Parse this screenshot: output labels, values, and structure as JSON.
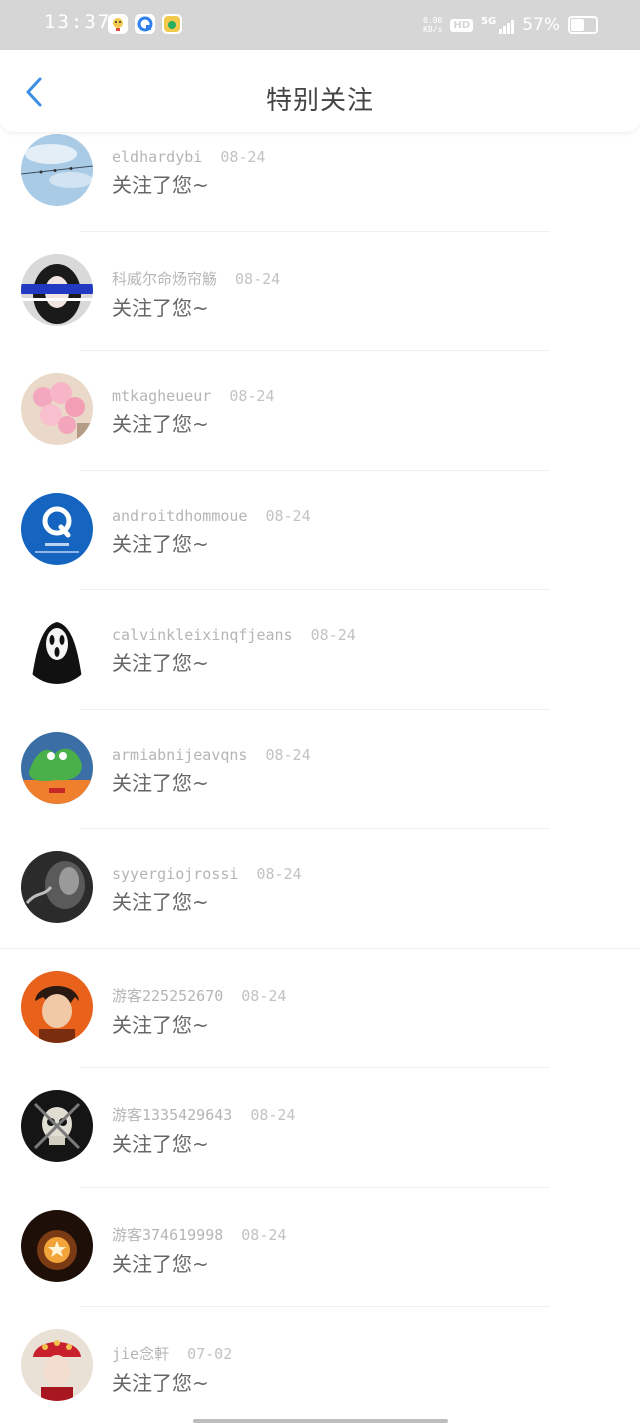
{
  "status_bar": {
    "time": "13:37",
    "net_speed_value": "0.00",
    "net_speed_unit": "KB/s",
    "hd_label": "HD",
    "network_label": "5G",
    "battery_percent": "57%",
    "battery_level": 0.57
  },
  "header": {
    "title": "特别关注",
    "back_icon": "chevron-left-icon",
    "accent_color": "#3a8ee6"
  },
  "items": [
    {
      "name": "eldhardybi",
      "date": "08-24",
      "message": "关注了您~",
      "avatar": "sky-birds-wire"
    },
    {
      "name": "科威尔命炀帘觞",
      "date": "08-24",
      "message": "关注了您~",
      "avatar": "girl-portrait"
    },
    {
      "name": "mtkagheueur",
      "date": "08-24",
      "message": "关注了您~",
      "avatar": "pink-balloons"
    },
    {
      "name": "androitdhommoue",
      "date": "08-24",
      "message": "关注了您~",
      "avatar": "q-logo"
    },
    {
      "name": "calvinkleixinqfjeans",
      "date": "08-24",
      "message": "关注了您~",
      "avatar": "ghost-mask"
    },
    {
      "name": "armiabnijeavqns",
      "date": "08-24",
      "message": "关注了您~",
      "avatar": "green-hands"
    },
    {
      "name": "syyergiojrossi",
      "date": "08-24",
      "message": "关注了您~",
      "avatar": "monochrome-smoke"
    },
    {
      "name": "游客225252670",
      "date": "08-24",
      "message": "关注了您~",
      "avatar": "anime-orange"
    },
    {
      "name": "游客1335429643",
      "date": "08-24",
      "message": "关注了您~",
      "avatar": "skull"
    },
    {
      "name": "游客374619998",
      "date": "08-24",
      "message": "关注了您~",
      "avatar": "star-lantern"
    },
    {
      "name": "jie念軒",
      "date": "07-02",
      "message": "关注了您~",
      "avatar": "red-headdress"
    }
  ]
}
